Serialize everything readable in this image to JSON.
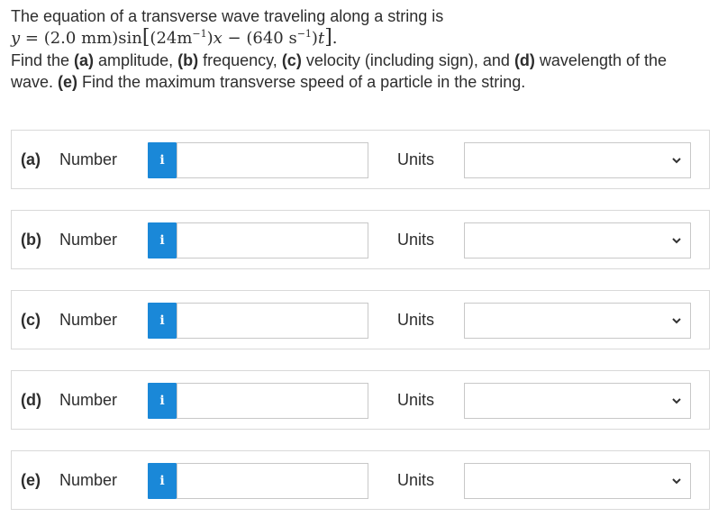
{
  "question": {
    "intro": "The equation of a transverse wave traveling along a string is",
    "equation": {
      "y": "y",
      "equals": " = ",
      "amp": "(2.0 mm)",
      "sin": "sin",
      "open_bracket": "[",
      "k_open": "(24m",
      "k_exp": "−1",
      "k_close": ")",
      "x": "x",
      "minus": " − ",
      "w_open": "(640 s",
      "w_exp": "−1",
      "w_close": ")",
      "t": "t",
      "close_bracket": "]",
      "period": "."
    },
    "line2_a": "Find the ",
    "a_tag": "(a)",
    "line2_b": " amplitude, ",
    "b_tag": "(b)",
    "line2_c": " frequency, ",
    "c_tag": "(c)",
    "line2_d": " velocity (including sign), and ",
    "d_tag": "(d)",
    "line2_e": " wavelength of the",
    "line3_a": "wave. ",
    "e_tag": "(e)",
    "line3_b": " Find the maximum transverse speed of a particle in the string."
  },
  "parts": [
    {
      "tag": "(a)",
      "number_label": "Number",
      "info_icon": "i",
      "value": "",
      "units_label": "Units",
      "units_value": ""
    },
    {
      "tag": "(b)",
      "number_label": "Number",
      "info_icon": "i",
      "value": "",
      "units_label": "Units",
      "units_value": ""
    },
    {
      "tag": "(c)",
      "number_label": "Number",
      "info_icon": "i",
      "value": "",
      "units_label": "Units",
      "units_value": ""
    },
    {
      "tag": "(d)",
      "number_label": "Number",
      "info_icon": "i",
      "value": "",
      "units_label": "Units",
      "units_value": ""
    },
    {
      "tag": "(e)",
      "number_label": "Number",
      "info_icon": "i",
      "value": "",
      "units_label": "Units",
      "units_value": ""
    }
  ],
  "colors": {
    "info_button": "#1a88d8",
    "border": "#d9d9d9",
    "text": "#2d2d2d"
  },
  "icons": {
    "info": "info-icon",
    "dropdown": "chevron-down-icon"
  }
}
